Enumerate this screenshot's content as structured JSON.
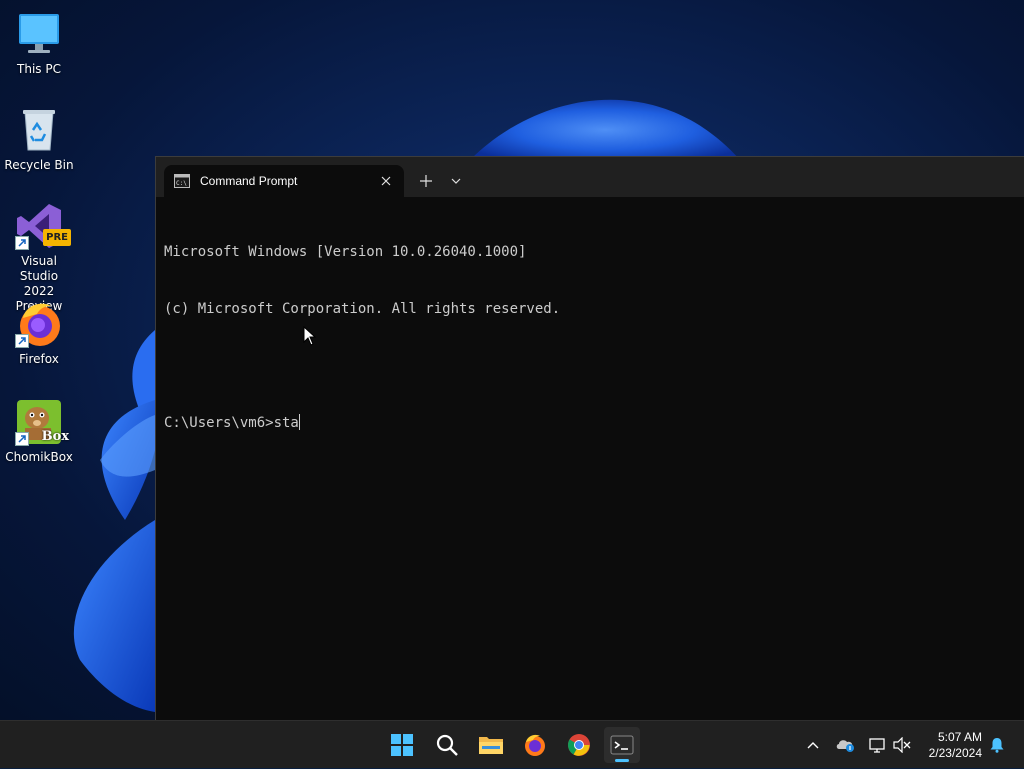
{
  "desktop_icons": [
    {
      "label": "This PC",
      "icon": "monitor-icon"
    },
    {
      "label": "Recycle Bin",
      "icon": "recycle-bin-icon"
    },
    {
      "label_line1": "Visual Studio",
      "label_line2": "2022 Preview",
      "badge": "PRE",
      "icon": "visual-studio-icon"
    },
    {
      "label": "Firefox",
      "icon": "firefox-icon"
    },
    {
      "label": "ChomikBox",
      "badge": "Box",
      "icon": "chomikbox-icon"
    }
  ],
  "terminal": {
    "tab_title": "Command Prompt",
    "lines": [
      "Microsoft Windows [Version 10.0.26040.1000]",
      "(c) Microsoft Corporation. All rights reserved.",
      "",
      "C:\\Users\\vm6>sta"
    ],
    "new_tab_symbol": "+",
    "dropdown_symbol": "⌄"
  },
  "taskbar": {
    "apps": [
      "start-icon",
      "search-icon",
      "file-explorer-icon",
      "firefox-icon",
      "chrome-icon",
      "terminal-icon"
    ],
    "active_app": "terminal-icon",
    "tray_icons": [
      "chevron-up-icon",
      "onedrive-icon",
      "network-icon",
      "volume-muted-icon",
      "notification-bell-icon"
    ],
    "time": "5:07 AM",
    "date": "2/23/2024"
  },
  "colors": {
    "accent": "#4cc2ff",
    "terminal_bg": "#0c0c0c",
    "taskbar_bg": "#202020"
  }
}
